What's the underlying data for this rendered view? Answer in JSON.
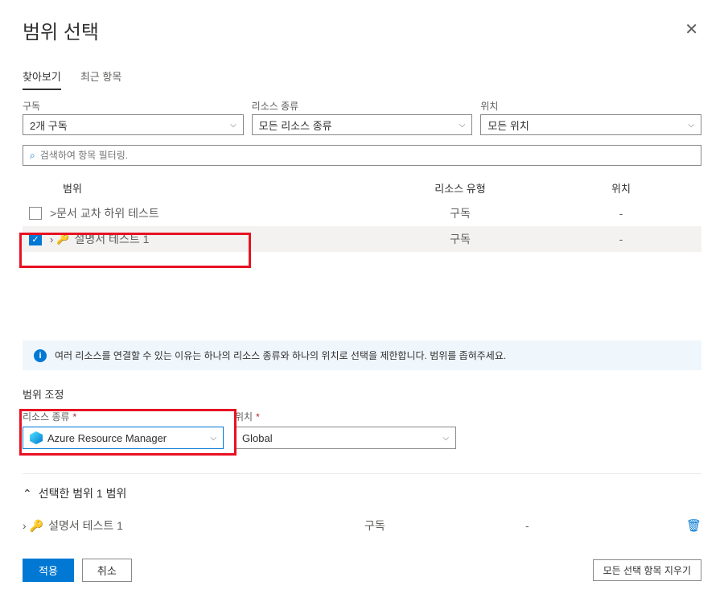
{
  "header": {
    "title": "범위 선택"
  },
  "tabs": {
    "browse": "찾아보기",
    "recent": "최근 항목"
  },
  "filters": {
    "subscription": {
      "label": "구독",
      "value": "2개 구독"
    },
    "resourceType": {
      "label": "리소스 종류",
      "value": "모든 리소스 종류"
    },
    "location": {
      "label": "위치",
      "value": "모든 위치"
    }
  },
  "search": {
    "placeholder": "검색하여 항목 필터링."
  },
  "tableHeaders": {
    "scope": "범위",
    "resourceType": "리소스 유형",
    "location": "위치"
  },
  "rows": [
    {
      "name": ">문서 교차 하위 테스트",
      "type": "구독",
      "location": "-",
      "checked": false
    },
    {
      "name": "설명서 테스트 1",
      "type": "구독",
      "location": "-",
      "checked": true
    }
  ],
  "info": "여러 리소스를 연결할 수 있는 이유는 하나의 리소스 종류와 하나의 위치로 선택을 제한합니다. 범위를 좁혀주세요.",
  "narrowSection": {
    "title": "범위 조정",
    "resourceType": {
      "label": "리소스 종류",
      "value": "Azure Resource Manager"
    },
    "location": {
      "label": "위치",
      "value": "Global"
    }
  },
  "selected": {
    "title": "선택한 범위 1 범위",
    "row": {
      "name": "설명서 테스트 1",
      "type": "구독",
      "location": "-"
    }
  },
  "buttons": {
    "apply": "적용",
    "cancel": "취소",
    "clearAll": "모든 선택 항목 지우기"
  }
}
